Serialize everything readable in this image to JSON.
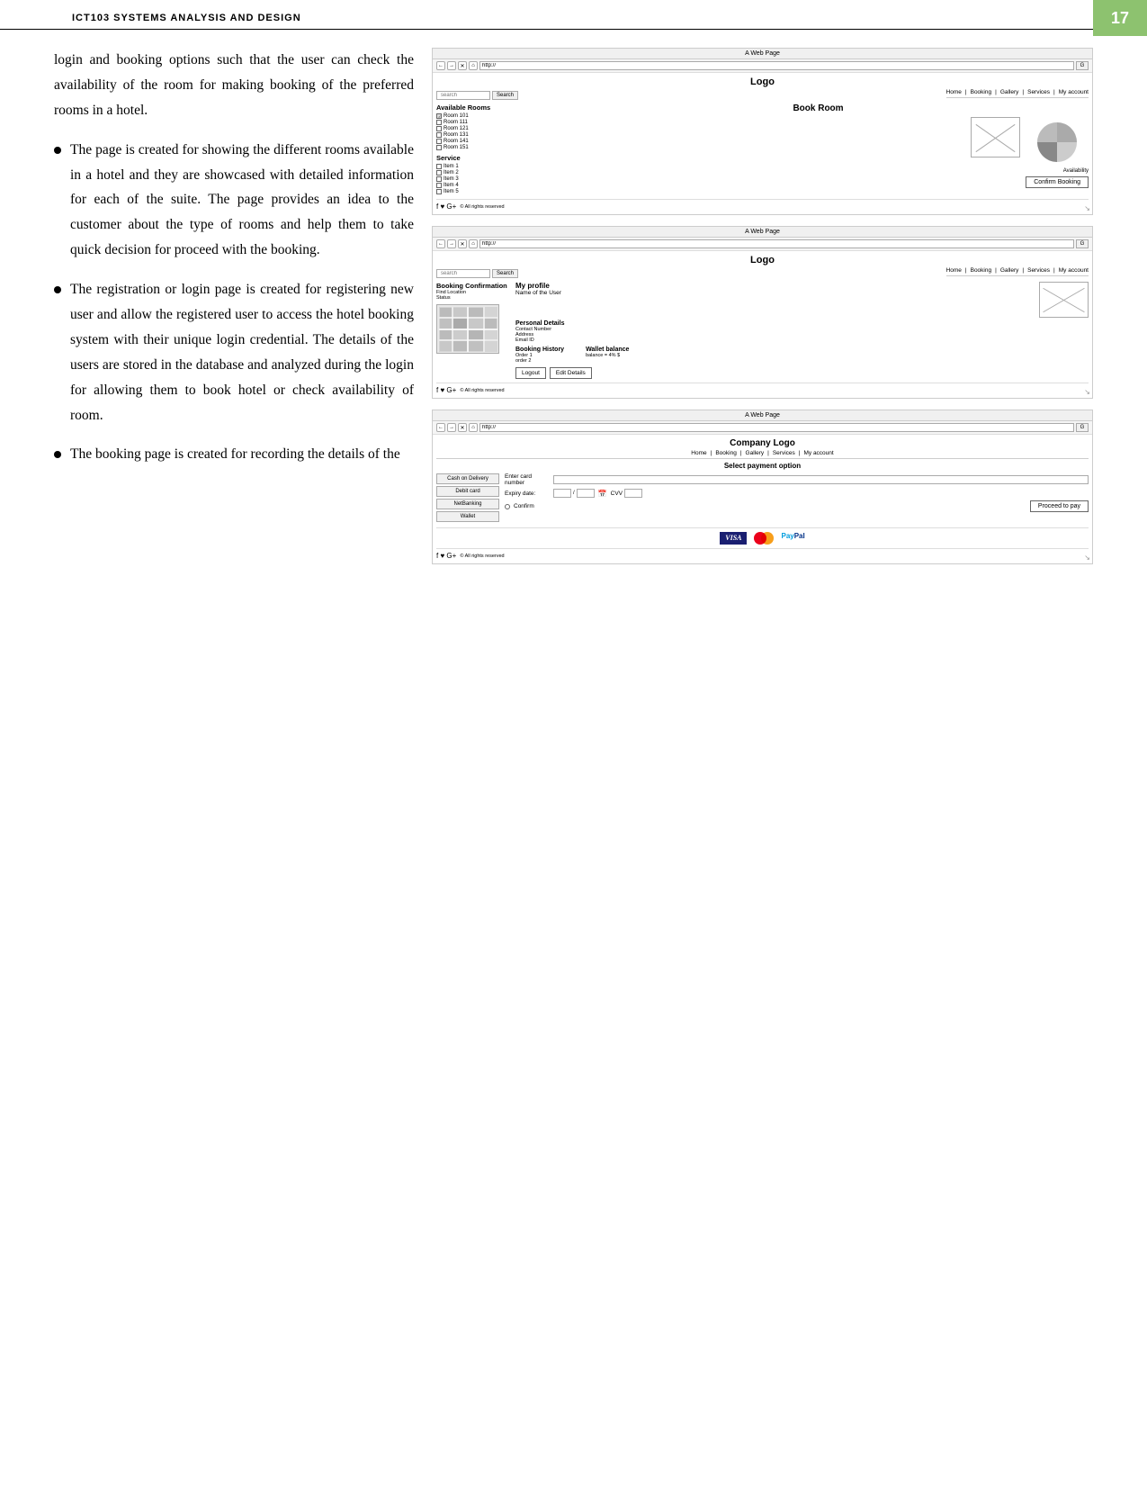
{
  "page": {
    "number": "17",
    "header_title": "ICT103 SYSTEMS ANALYSIS AND DESIGN"
  },
  "intro_text": "login and booking options such that the user can check the availability of the room for making booking of the preferred rooms in a hotel.",
  "bullet1": {
    "text": "The page is created for showing the different rooms available in a hotel and they are showcased with detailed information for each of the suite. The page provides an idea to the customer about the type of rooms and help them to take quick decision for proceed with the booking."
  },
  "bullet2": {
    "text": "The registration or login page is created for registering new user and allow the registered user to access the hotel booking system with their unique login credential. The details of the users are stored in the database and analyzed during the login for allowing them to book hotel or check availability of room."
  },
  "bullet3": {
    "text_start": "The booking page is created for recording the details of the"
  },
  "wireframe1": {
    "title_bar": "A Web Page",
    "url": "http://",
    "logo": "Logo",
    "page_title": "Book Room",
    "nav": [
      "Home",
      "Booking",
      "Gallery",
      "Services",
      "My account"
    ],
    "search_placeholder": "search",
    "search_btn": "Search",
    "available_rooms_title": "Available Rooms",
    "rooms": [
      "Room 101",
      "Room 111",
      "Room 121",
      "Room 131",
      "Room 141",
      "Room 151"
    ],
    "room_checked": [
      true,
      false,
      false,
      false,
      false,
      false
    ],
    "service_title": "Service",
    "services": [
      "Item 1",
      "Item 2",
      "Item 3",
      "Item 4",
      "Item 5"
    ],
    "availability_label": "Availability",
    "confirm_btn": "Confirm Booking",
    "footer_social": "f ♥ G+",
    "footer_copyright": "© All rights reserved"
  },
  "wireframe2": {
    "title_bar": "A Web Page",
    "url": "http://",
    "logo": "Logo",
    "nav": [
      "Home",
      "Booking",
      "Gallery",
      "Services",
      "My account"
    ],
    "search_placeholder": "search",
    "search_btn": "Search",
    "booking_confirmation": "Booking Confirmation",
    "find_location": "Find Location",
    "status": "Status",
    "my_profile": "My profile",
    "name_of_user": "Name of the User",
    "personal_details": "Personal Details",
    "contact_number": "Contact Number",
    "address": "Address",
    "email_id": "Email ID",
    "booking_history": "Booking History",
    "order1": "Order 1",
    "order2": "order 2",
    "wallet_balance": "Wallet balance",
    "balance": "balance = 4% $",
    "logout_btn": "Logout",
    "edit_details_btn": "Edit Details",
    "footer_social": "f ♥ G+",
    "footer_copyright": "© All rights reserved"
  },
  "wireframe3": {
    "title_bar": "A Web Page",
    "url": "http://",
    "logo": "Company Logo",
    "nav": [
      "Home",
      "Booking",
      "Gallery",
      "Services",
      "My account"
    ],
    "select_payment_title": "Select payment option",
    "cash_on_delivery": "Cash on Delivery",
    "debit_card": "Debit card",
    "net_banking": "NetBanking",
    "wallet": "Wallet",
    "enter_card_number_label": "Enter card number",
    "expiry_date_label": "Expiry date:",
    "expiry_slash": "/",
    "cvv_label": "CVV",
    "confirm_label": "Confirm",
    "proceed_btn": "Proceed to pay",
    "footer_social": "f ♥ G+",
    "footer_copyright": "© All rights reserved",
    "visa_label": "VISA",
    "paypal_label": "PayPal"
  }
}
